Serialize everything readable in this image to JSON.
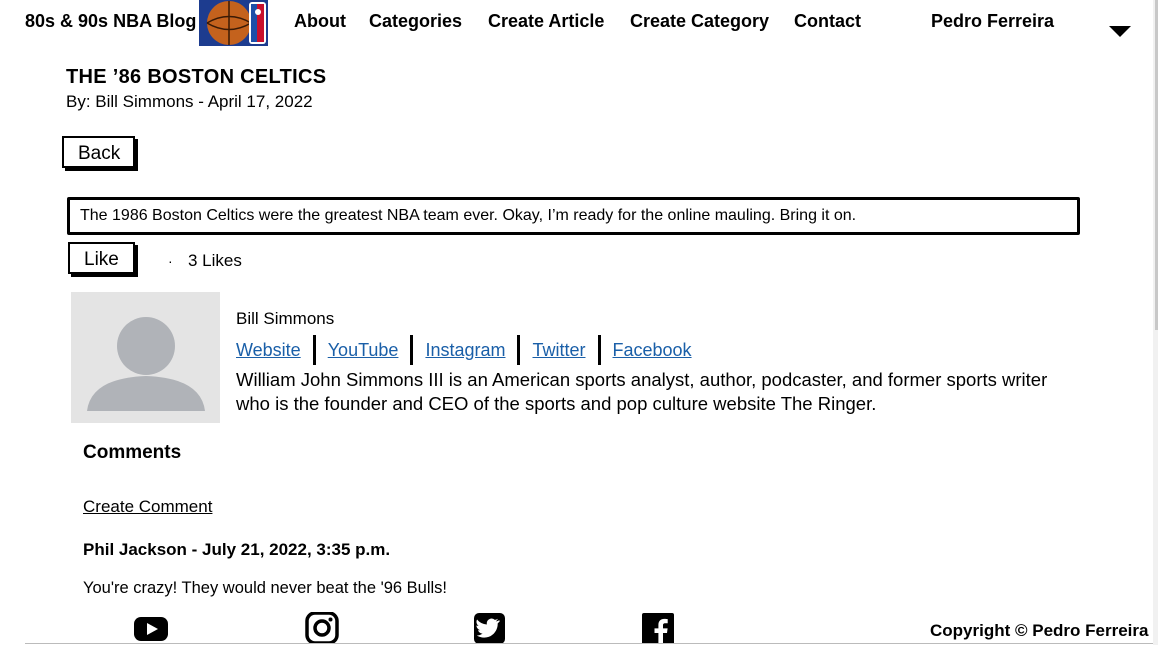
{
  "nav": {
    "brand": "80s & 90s NBA Blog",
    "links": [
      "About",
      "Categories",
      "Create Article",
      "Create Category",
      "Contact"
    ],
    "user": "Pedro Ferreira"
  },
  "article": {
    "title": "THE ’86 BOSTON CELTICS",
    "byline": "By: Bill Simmons - April 17, 2022",
    "back_label": "Back",
    "content": "The 1986 Boston Celtics were the greatest NBA team ever. Okay, I’m ready for the online mauling. Bring it on.",
    "like_label": "Like",
    "likes_dot": "·",
    "likes_text": "3 Likes"
  },
  "author": {
    "name": "Bill Simmons",
    "links": [
      "Website",
      "YouTube",
      "Instagram",
      "Twitter",
      "Facebook"
    ],
    "bio": "William John Simmons III is an American sports analyst, author, podcaster, and former sports writer who is the founder and CEO of the sports and pop culture website The Ringer."
  },
  "comments": {
    "heading": "Comments",
    "create_label": "Create Comment",
    "items": [
      {
        "meta": "Phil Jackson - July 21, 2022, 3:35 p.m.",
        "text": "You're crazy! They would never beat the '96 Bulls!"
      }
    ]
  },
  "footer": {
    "icons": [
      "youtube-icon",
      "instagram-icon",
      "twitter-icon",
      "facebook-icon"
    ],
    "copyright": "Copyright © Pedro Ferreira"
  },
  "colors": {
    "link": "#1a5fa8",
    "avatar_bg": "#e4e4e4",
    "avatar_fg": "#b0b3b8"
  }
}
